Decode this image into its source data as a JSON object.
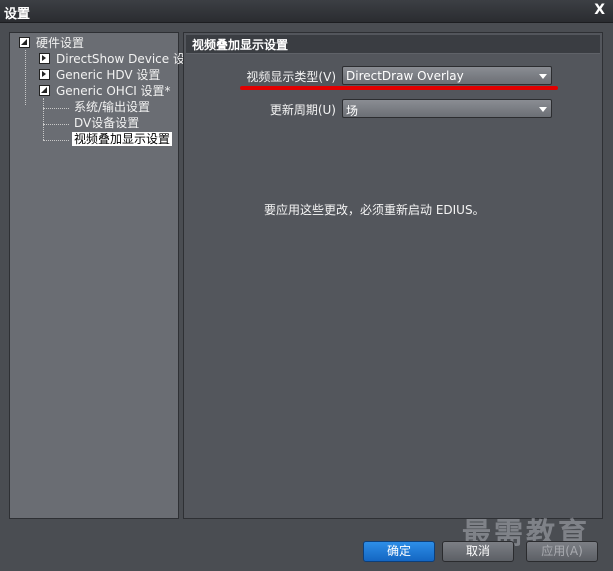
{
  "window": {
    "title": "设置",
    "close_label": "X"
  },
  "tree": {
    "root": "硬件设置",
    "items": [
      "DirectShow Device 设置",
      "Generic HDV 设置",
      "Generic OHCI 设置*"
    ],
    "children": [
      "系统/输出设置",
      "DV设备设置",
      "视频叠加显示设置"
    ]
  },
  "panel": {
    "title": "视频叠加显示设置",
    "display_type_label": "视频显示类型(V)",
    "display_type_value": "DirectDraw Overlay",
    "update_cycle_label": "更新周期(U)",
    "update_cycle_value": "场",
    "notice": "要应用这些更改，必须重新启动 EDIUS。"
  },
  "buttons": {
    "ok": "确定",
    "cancel": "取消",
    "apply": "应用(A)"
  },
  "watermark": "最需教育",
  "colors": {
    "annotation_line": "#e00000",
    "primary_button": "#1f78d8"
  }
}
